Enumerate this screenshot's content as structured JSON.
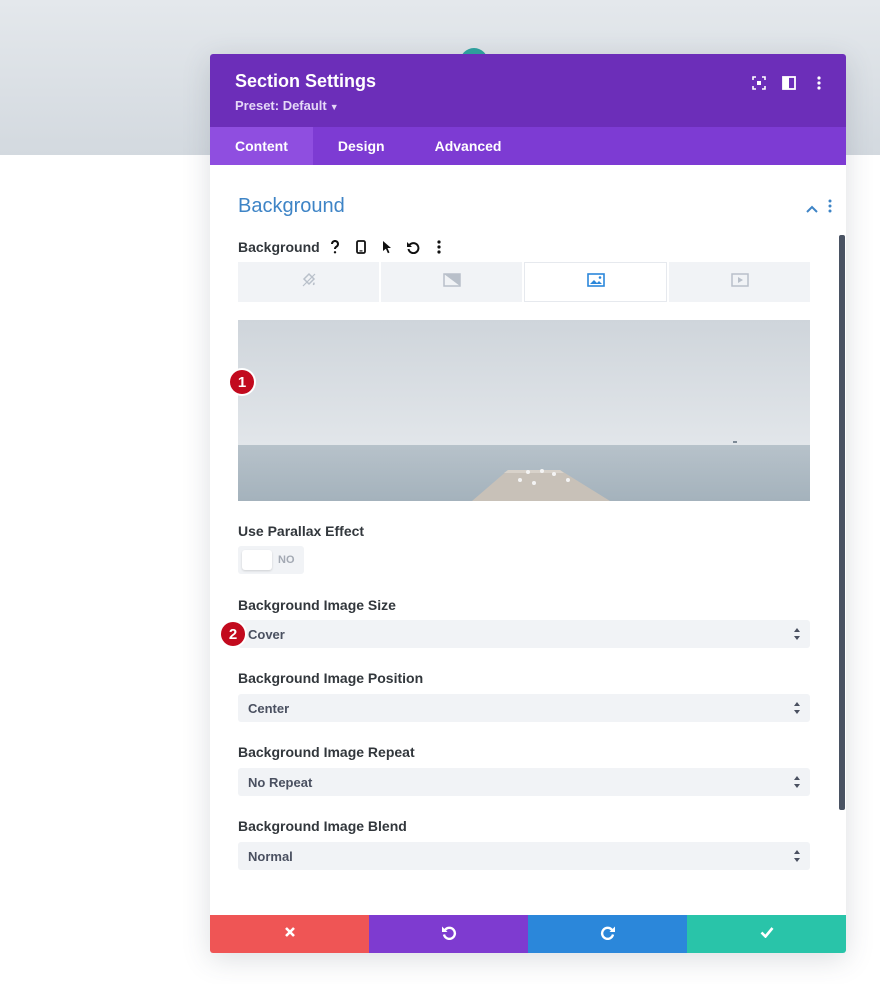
{
  "modal": {
    "title": "Section Settings",
    "preset": "Preset: Default",
    "header_icons": [
      "focus-icon",
      "split-layout-icon",
      "more-vertical-icon"
    ],
    "colors": {
      "header": "#6c2eb9",
      "tabs": "#7d3bd3",
      "active_tab": "#8f4ee0",
      "section_title": "#3e84c6",
      "marker": "#c20a1e"
    }
  },
  "tabs": [
    {
      "label": "Content",
      "active": true
    },
    {
      "label": "Design",
      "active": false
    },
    {
      "label": "Advanced",
      "active": false
    }
  ],
  "section": {
    "title": "Background"
  },
  "background_field": {
    "label": "Background",
    "tools": [
      "help-icon",
      "mobile-icon",
      "cursor-icon",
      "undo-icon",
      "more-vertical-icon"
    ],
    "types": [
      {
        "icon": "paint-bucket-icon",
        "active": false
      },
      {
        "icon": "gradient-icon",
        "active": false
      },
      {
        "icon": "image-icon",
        "active": true
      },
      {
        "icon": "video-icon",
        "active": false
      }
    ]
  },
  "markers": {
    "one": "1",
    "two": "2"
  },
  "parallax": {
    "label": "Use Parallax Effect",
    "value": "NO"
  },
  "fields": [
    {
      "label": "Background Image Size",
      "value": "Cover"
    },
    {
      "label": "Background Image Position",
      "value": "Center"
    },
    {
      "label": "Background Image Repeat",
      "value": "No Repeat"
    },
    {
      "label": "Background Image Blend",
      "value": "Normal"
    }
  ],
  "footer": {
    "buttons": [
      {
        "name": "discard",
        "icon": "close-icon",
        "color": "#ef5555"
      },
      {
        "name": "undo",
        "icon": "undo-icon",
        "color": "#7e3bd0"
      },
      {
        "name": "redo",
        "icon": "redo-icon",
        "color": "#2b87da"
      },
      {
        "name": "save",
        "icon": "check-icon",
        "color": "#29c4a9"
      }
    ]
  }
}
